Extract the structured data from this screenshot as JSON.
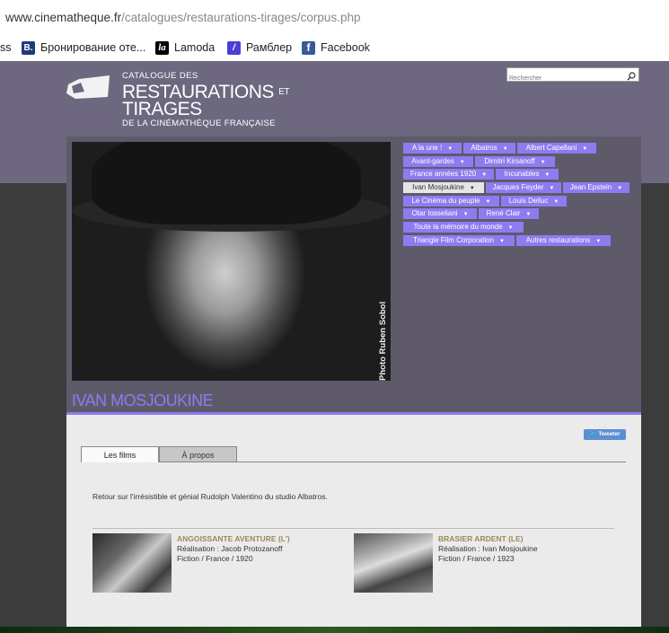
{
  "browser": {
    "url_host": "www.cinematheque.fr",
    "url_path": "/catalogues/restaurations-tirages/corpus.php",
    "bookmarks": [
      {
        "label": "ss",
        "icon": "none"
      },
      {
        "label": "Бронирование оте...",
        "icon": "b-icon",
        "glyph": "B."
      },
      {
        "label": "Lamoda",
        "icon": "lamoda-icon",
        "glyph": "la"
      },
      {
        "label": "Рамблер",
        "icon": "rambler-icon",
        "glyph": "/"
      },
      {
        "label": "Facebook",
        "icon": "facebook-icon",
        "glyph": "f"
      }
    ]
  },
  "header": {
    "logo_line1": "CATALOGUE DES",
    "logo_line2": "RESTAURATIONS",
    "logo_line2_small": "ET",
    "logo_line3": "TIRAGES",
    "logo_line4": "DE LA CINÉMATHÈQUE FRANÇAISE",
    "search_placeholder": "Rechercher"
  },
  "photo": {
    "credit": "Photo Ruben Sobol"
  },
  "menu": {
    "items": [
      {
        "label": "A la une !",
        "selected": false
      },
      {
        "label": "Albatros",
        "selected": false
      },
      {
        "label": "Albert Capellani",
        "selected": false
      },
      {
        "label": "Avant-gardes",
        "selected": false
      },
      {
        "label": "Dimitri Kirsanoff",
        "selected": false
      },
      {
        "label": "France années 1920",
        "selected": false
      },
      {
        "label": "Incunables",
        "selected": false
      },
      {
        "label": "Ivan Mosjoukine",
        "selected": true
      },
      {
        "label": "Jacques Feyder",
        "selected": false
      },
      {
        "label": "Jean Epstein",
        "selected": false
      },
      {
        "label": "Le Cinéma du peuple",
        "selected": false
      },
      {
        "label": "Louis Delluc",
        "selected": false
      },
      {
        "label": "Otar Iosseliani",
        "selected": false
      },
      {
        "label": "René Clair",
        "selected": false
      },
      {
        "label": "Toute la mémoire du monde",
        "selected": false
      },
      {
        "label": "Triangle Film Corporation",
        "selected": false
      },
      {
        "label": "Autres restaurations",
        "selected": false
      }
    ]
  },
  "page": {
    "title": "IVAN MOSJOUKINE",
    "tweet_label": "Tweeter",
    "tabs": [
      {
        "label": "Les films",
        "active": true
      },
      {
        "label": "À propos",
        "active": false
      }
    ],
    "description": "Retour sur l'irrésistible et génial Rudolph Valentino du studio Albatros."
  },
  "films": [
    {
      "title": "ANGOISSANTE AVENTURE (L')",
      "director": "Réalisation : Jacob Protozanoff",
      "meta": "Fiction / France / 1920"
    },
    {
      "title": "BRASIER ARDENT (LE)",
      "director": "Réalisation : Ivan Mosjoukine",
      "meta": "Fiction / France / 1923"
    }
  ],
  "colors": {
    "accent": "#8c7cf0",
    "header_band": "#6d687f",
    "film_title": "#9a8a5a",
    "tweet": "#5b8fd2"
  }
}
